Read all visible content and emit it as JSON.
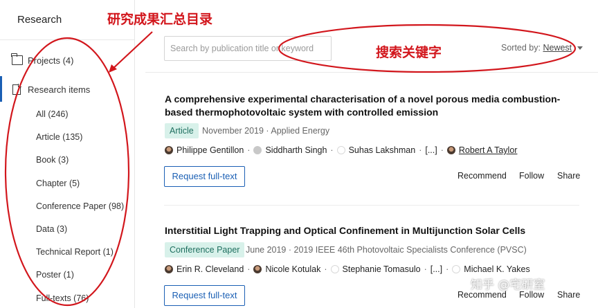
{
  "sidebar": {
    "title": "Research",
    "projects_label": "Projects (4)",
    "research_items_label": "Research items",
    "items": [
      {
        "label": "All (246)"
      },
      {
        "label": "Article (135)"
      },
      {
        "label": "Book (3)"
      },
      {
        "label": "Chapter (5)"
      },
      {
        "label": "Conference Paper (98)"
      },
      {
        "label": "Data (3)"
      },
      {
        "label": "Technical Report (1)"
      },
      {
        "label": "Poster (1)"
      },
      {
        "label": "Full-texts (76)"
      }
    ]
  },
  "search": {
    "placeholder": "Search by publication title or keyword"
  },
  "sort": {
    "label": "Sorted by:",
    "value": "Newest"
  },
  "publications": [
    {
      "title": "A comprehensive experimental characterisation of a novel porous media combustion-based thermophotovoltaic system with controlled emission",
      "type": "Article",
      "meta": "November 2019 · Applied Energy",
      "authors": [
        "Philippe Gentillon",
        "Siddharth Singh",
        "Suhas Lakshman",
        "[...]",
        "Robert A Taylor"
      ],
      "request_label": "Request full-text",
      "actions": [
        "Recommend",
        "Follow",
        "Share"
      ]
    },
    {
      "title": "Interstitial Light Trapping and Optical Confinement in Multijunction Solar Cells",
      "type": "Conference Paper",
      "meta": "June 2019 · 2019 IEEE 46th Photovoltaic Specialists Conference (PVSC)",
      "authors": [
        "Erin R. Cleveland",
        "Nicole Kotulak",
        "Stephanie Tomasulo",
        "[...]",
        "Michael K. Yakes"
      ],
      "request_label": "Request full-text",
      "actions": [
        "Recommend",
        "Follow",
        "Share"
      ]
    }
  ],
  "annotations": {
    "sidebar_note": "研究成果汇总目录",
    "search_note": "搜索关键字",
    "watermark": "知乎 @宅研室",
    "color": "#d2161c"
  },
  "colors": {
    "accent": "#1a5fb4",
    "badge_bg": "#d8f1ea",
    "badge_text": "#1f6f5f"
  }
}
